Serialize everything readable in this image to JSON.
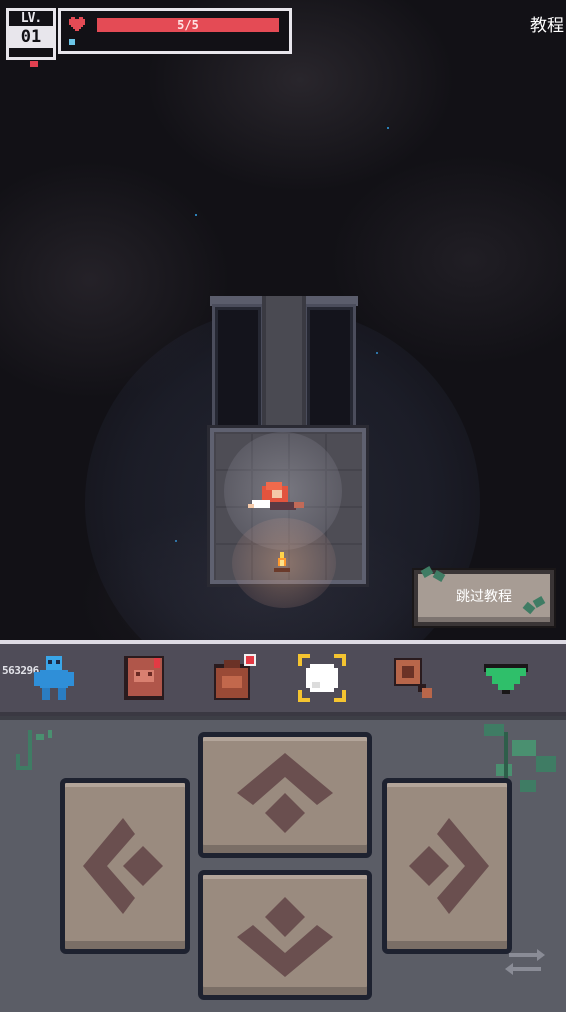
{
  "hud": {
    "level_label": "LV.",
    "level_value": "01",
    "hp_text": "5/5",
    "hp_current": 5,
    "hp_max": 5,
    "tutorial_label": "教程"
  },
  "skip_button": {
    "label": "跳过教程"
  },
  "toolbar": {
    "seed_text": "563296",
    "items": [
      {
        "name": "character-icon"
      },
      {
        "name": "journal-icon"
      },
      {
        "name": "backpack-icon"
      },
      {
        "name": "action-icon"
      },
      {
        "name": "magnifier-icon"
      },
      {
        "name": "collapse-icon"
      }
    ]
  },
  "controls": {
    "buttons": [
      "up",
      "left",
      "right",
      "down"
    ],
    "extra": "swap-icon"
  },
  "colors": {
    "hp_fill": "#e44b55",
    "hud_border": "#e8e6ec",
    "button_face": "#9a8b7f",
    "toolbar_bg": "#4f4c58",
    "controls_bg": "#5b5d66"
  }
}
